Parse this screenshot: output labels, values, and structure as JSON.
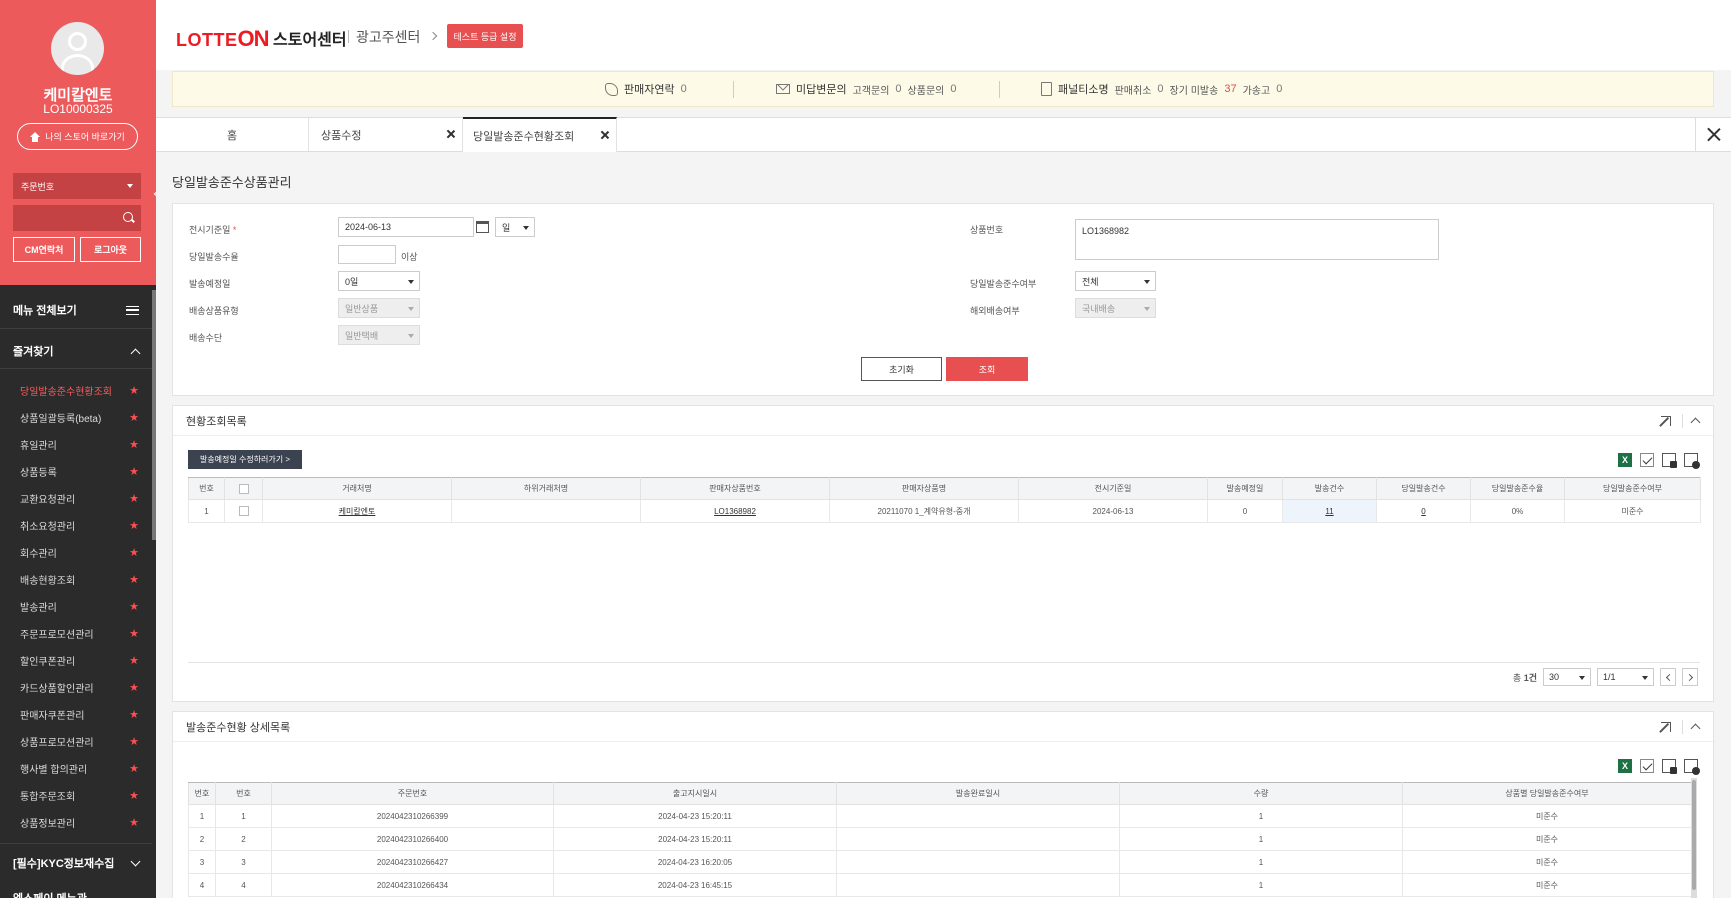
{
  "sidebar": {
    "seller_name": "케미칼엔토",
    "seller_id": "LO10000325",
    "store_button": "나의 스토어 바로가기",
    "order_select": "주문번호",
    "cm_contact": "CM연락처",
    "logout": "로그아웃",
    "menu_all": "메뉴 전체보기",
    "favorites_title": "즐겨찾기",
    "favorites": [
      "당일발송준수현황조회",
      "상품일괄등록(beta)",
      "휴일관리",
      "상품등록",
      "교환요청관리",
      "취소요청관리",
      "회수관리",
      "배송현황조회",
      "발송관리",
      "주문프로모션관리",
      "할인쿠폰관리",
      "카드상품할인관리",
      "판매자쿠폰관리",
      "상품프로모션관리",
      "행사별 합의관리",
      "통합주문조회",
      "상품정보관리"
    ],
    "kyc_title": "[필수]KYC정보재수집",
    "cut_item": "엘스페이 메뉴관"
  },
  "header": {
    "logo_text": "LOTTE",
    "logo_on": "ON",
    "store_center": "스토어센터",
    "ad_center": "광고주센터",
    "test_badge": "테스트 등급 설정"
  },
  "notice": {
    "seller_contact": "판매자연락",
    "seller_contact_count": "0",
    "unanswered": "미답변문의",
    "customer_inquiry": "고객문의",
    "customer_inquiry_count": "0",
    "product_inquiry": "상품문의",
    "product_inquiry_count": "0",
    "penalty": "패널티소명",
    "sale_cancel": "판매취소",
    "sale_cancel_count": "0",
    "long_unshipped": "장기 미발송",
    "long_unshipped_count": "37",
    "fake_ship": "가송고",
    "fake_ship_count": "0"
  },
  "tabs": [
    {
      "label": "홈"
    },
    {
      "label": "상품수정"
    },
    {
      "label": "당일발송준수현황조회"
    }
  ],
  "page_title": "당일발송준수상품관리",
  "search": {
    "display_date_label": "전시기준일",
    "display_date_value": "2024-06-13",
    "period_unit": "일",
    "same_day_count_label": "당일발송수율",
    "same_day_count_suffix": "이상",
    "ship_due_label": "발송예정일",
    "ship_due_value": "0일",
    "ship_type_label": "배송상품유형",
    "ship_type_value": "일반상품",
    "ship_method_label": "배송수단",
    "ship_method_value": "일반택배",
    "product_no_label": "상품번호",
    "product_no_value": "LO1368982",
    "compliance_label": "당일발송준수여부",
    "compliance_value": "전체",
    "overseas_label": "해외배송여부",
    "overseas_value": "국내배송",
    "reset_button": "초기화",
    "search_button": "조회"
  },
  "list_panel": {
    "title": "현황조회목록",
    "edit_button": "발송예정일 수정하러가기 >",
    "columns": [
      "번호",
      "",
      "거래처명",
      "하위거래처명",
      "판매자상품번호",
      "판매자상품명",
      "전시기준일",
      "발송예정일",
      "발송건수",
      "당일발송건수",
      "당일발송준수율",
      "당일발송준수여부"
    ],
    "rows": [
      [
        "1",
        "",
        "케미칼엔토",
        "",
        "LO1368982",
        "20211070 1_계약유형-중개",
        "2024-06-13",
        "0",
        "11",
        "0",
        "0%",
        "미준수"
      ]
    ],
    "total_label": "총",
    "total_count": "1건",
    "page_size": "30",
    "page": "1/1",
    "excel_icon_label": "X"
  },
  "detail_panel": {
    "title": "발송준수현황 상세목록",
    "excel_icon_label": "X",
    "columns": [
      "번호",
      "번호",
      "주문번호",
      "출고지시일시",
      "발송완료일시",
      "수량",
      "상품별 당일발송준수여부"
    ],
    "rows": [
      [
        "1",
        "1",
        "2024042310266399",
        "2024-04-23 15:20:11",
        "",
        "1",
        "미준수"
      ],
      [
        "2",
        "2",
        "2024042310266400",
        "2024-04-23 15:20:11",
        "",
        "1",
        "미준수"
      ],
      [
        "3",
        "3",
        "2024042310266427",
        "2024-04-23 16:20:05",
        "",
        "1",
        "미준수"
      ],
      [
        "4",
        "4",
        "2024042310266434",
        "2024-04-23 16:45:15",
        "",
        "1",
        "미준수"
      ]
    ]
  },
  "colors": {
    "brand_red": "#ed5a5c",
    "sidebar_dark": "#2b2b2b",
    "search_button": "#e84f51"
  }
}
